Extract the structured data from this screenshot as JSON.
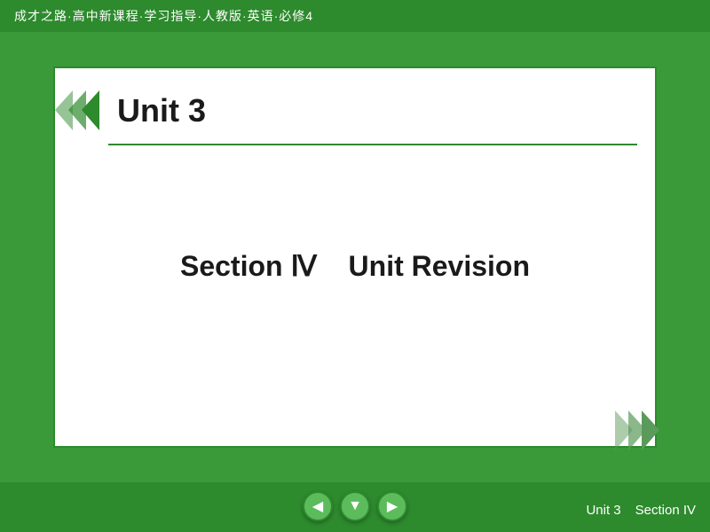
{
  "header": {
    "title": "成才之路·高中新课程·学习指导·人教版·英语·必修4"
  },
  "slide": {
    "unit_label": "Unit 3",
    "section_label": "Section Ⅳ",
    "revision_label": "Unit Revision"
  },
  "nav": {
    "prev_label": "◀",
    "home_label": "▼",
    "next_label": "▶"
  },
  "footer": {
    "unit": "Unit 3",
    "section": "Section IV"
  }
}
